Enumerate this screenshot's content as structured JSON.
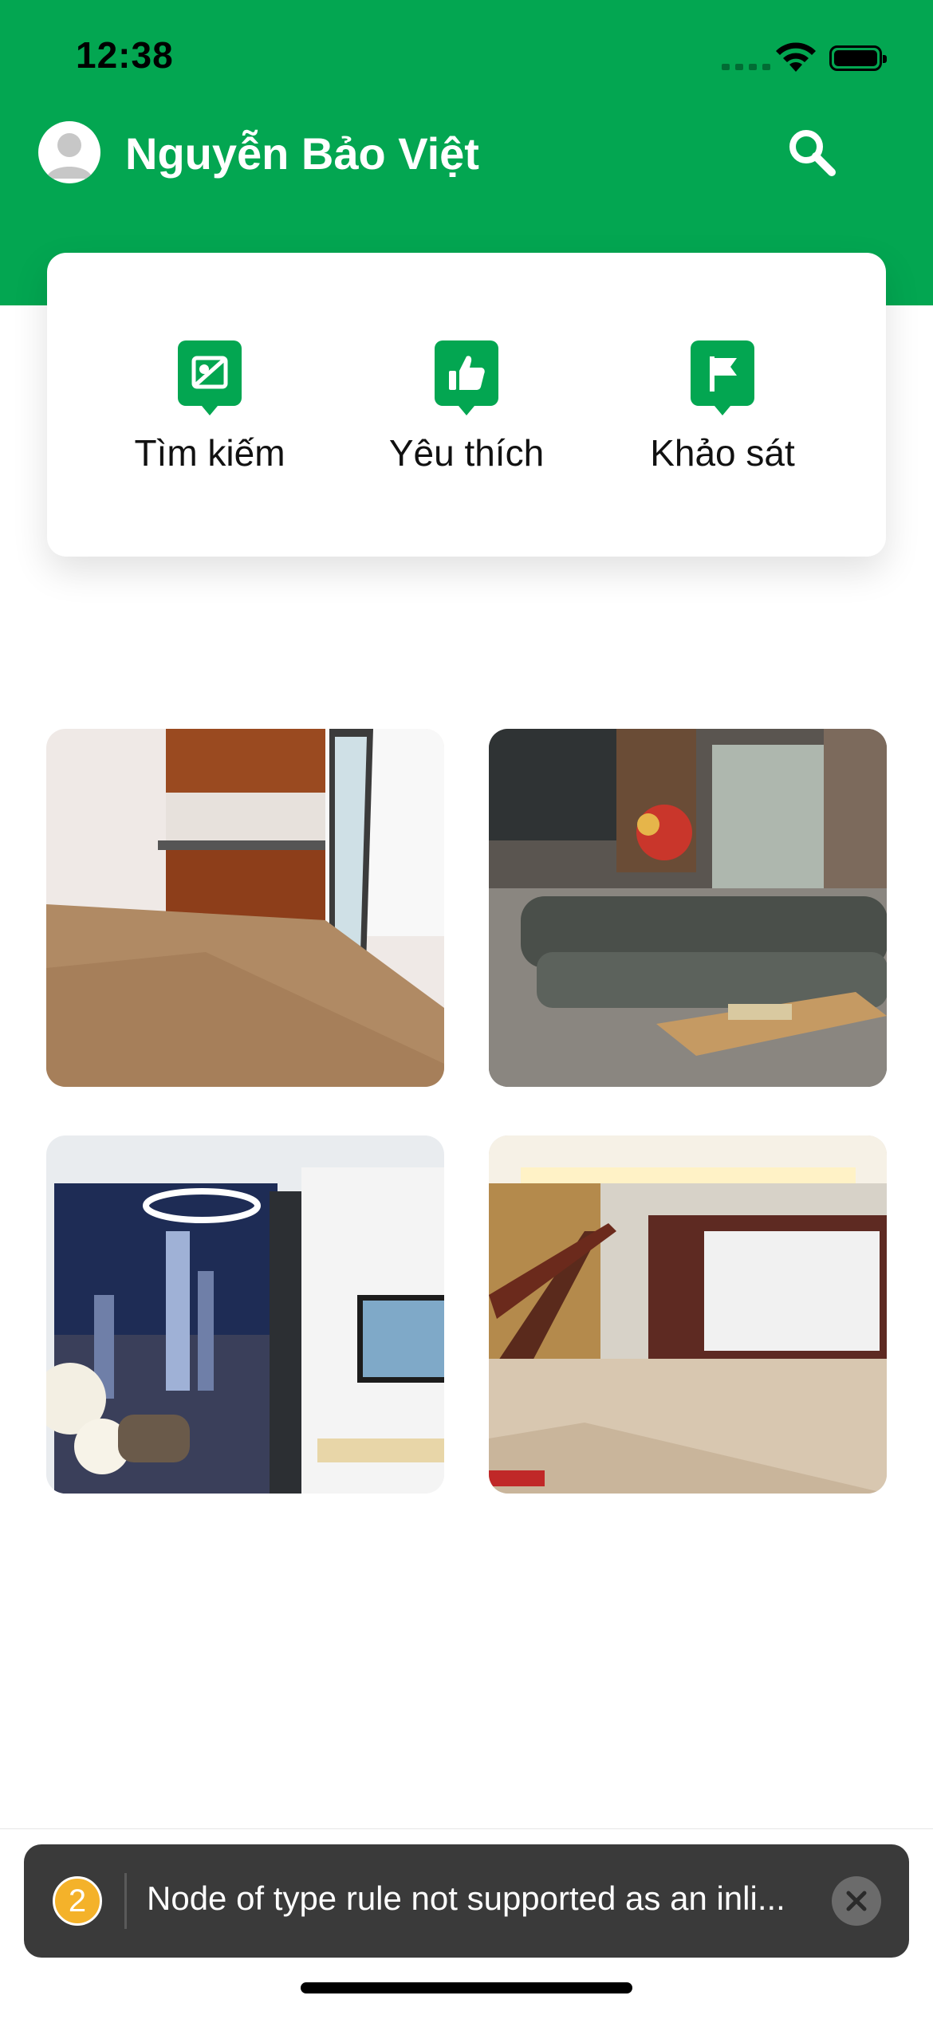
{
  "status_bar": {
    "time": "12:38"
  },
  "header": {
    "user_name": "Nguyễn Bảo Việt",
    "search_icon": "search-icon",
    "avatar_icon": "person-avatar-icon"
  },
  "colors": {
    "brand_green": "#03a651",
    "toast_bg": "#3a3a3a",
    "badge_yellow": "#f4b22a"
  },
  "quick_actions": [
    {
      "label": "Tìm kiếm",
      "icon": "map-search-icon"
    },
    {
      "label": "Yêu thích",
      "icon": "thumbs-up-icon"
    },
    {
      "label": "Khảo sát",
      "icon": "flag-icon"
    }
  ],
  "gallery": [
    {
      "subject": "empty-kitchen-room"
    },
    {
      "subject": "living-room-sofa"
    },
    {
      "subject": "city-view-living-room"
    },
    {
      "subject": "hall-with-staircase"
    }
  ],
  "toast": {
    "count": "2",
    "message": "Node of type rule not supported as an inli..."
  }
}
